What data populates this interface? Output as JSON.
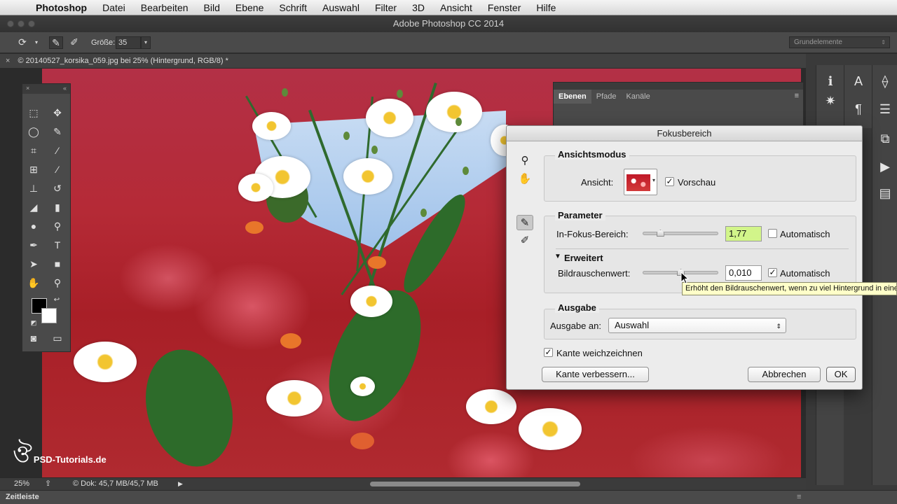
{
  "menubar": {
    "app": "Photoshop",
    "items": [
      "Datei",
      "Bearbeiten",
      "Bild",
      "Ebene",
      "Schrift",
      "Auswahl",
      "Filter",
      "3D",
      "Ansicht",
      "Fenster",
      "Hilfe"
    ]
  },
  "window": {
    "title": "Adobe Photoshop CC 2014"
  },
  "options": {
    "size_label": "Größe:",
    "size_value": "35",
    "workspace": "Grundelemente"
  },
  "document": {
    "tab_title": "© 20140527_korsika_059.jpg bei 25% (Hintergrund, RGB/8) *"
  },
  "layers_panel": {
    "tabs": [
      "Ebenen",
      "Pfade",
      "Kanäle"
    ]
  },
  "dialog": {
    "title": "Fokusbereich",
    "view_mode": {
      "heading": "Ansichtsmodus",
      "view_label": "Ansicht:",
      "preview_label": "Vorschau",
      "preview_checked": true
    },
    "parameters": {
      "heading": "Parameter",
      "in_focus_label": "In-Fokus-Bereich:",
      "in_focus_value": "1,77",
      "in_focus_slider": 0.23,
      "in_focus_auto_label": "Automatisch",
      "in_focus_auto_checked": false,
      "advanced_label": "Erweitert",
      "noise_label": "Bildrauschenwert:",
      "noise_value": "0,010",
      "noise_slider": 0.5,
      "noise_auto_label": "Automatisch",
      "noise_auto_checked": true
    },
    "output": {
      "heading": "Ausgabe",
      "output_to_label": "Ausgabe an:",
      "output_to_value": "Auswahl"
    },
    "soften_edge_label": "Kante weichzeichnen",
    "soften_edge_checked": true,
    "refine_edge_button": "Kante verbessern...",
    "cancel_button": "Abbrechen",
    "ok_button": "OK"
  },
  "tooltip": "Erhöht den Bildrauschenwert, wenn zu viel Hintergrund in eine",
  "status": {
    "zoom": "25%",
    "doc_info": "© Dok: 45,7 MB/45,7 MB"
  },
  "timeline": {
    "label": "Zeitleiste"
  },
  "watermark": {
    "text": "PSD-Tutorials.de"
  },
  "colors": {
    "overlay_red": "#b52a36",
    "preview_field_highlight": "#d2f58a",
    "tooltip_bg": "#ffffc8"
  },
  "icons": {
    "tools": [
      "marquee-icon",
      "move-icon",
      "lasso-icon",
      "quick-selection-icon",
      "crop-icon",
      "eyedropper-icon",
      "healing-brush-icon",
      "brush-icon",
      "clone-stamp-icon",
      "history-brush-icon",
      "eraser-icon",
      "gradient-icon",
      "blur-icon",
      "dodge-icon",
      "pen-icon",
      "type-icon",
      "path-selection-icon",
      "rectangle-icon",
      "hand-icon",
      "zoom-icon"
    ]
  }
}
